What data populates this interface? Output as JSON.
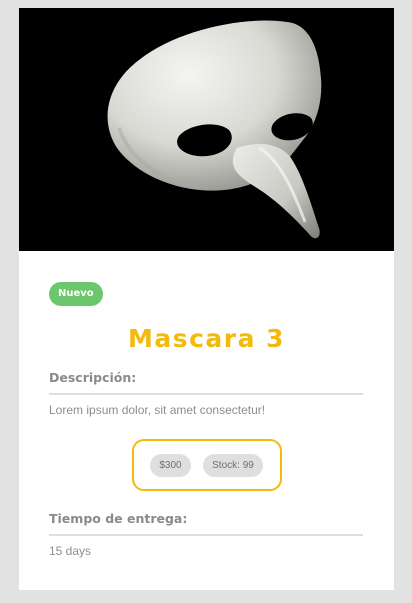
{
  "product": {
    "badge": "Nuevo",
    "title": "Mascara 3",
    "description_label": "Descripción:",
    "description_text": "Lorem ipsum dolor, sit amet consectetur!",
    "price": "$300",
    "stock": "Stock: 99",
    "delivery_label": "Tiempo de entrega:",
    "delivery_value": "15 days"
  },
  "colors": {
    "accent": "#f4b90d",
    "badge": "#6cc66c",
    "image_background": "#000000",
    "page_background": "#e2e2e2"
  }
}
